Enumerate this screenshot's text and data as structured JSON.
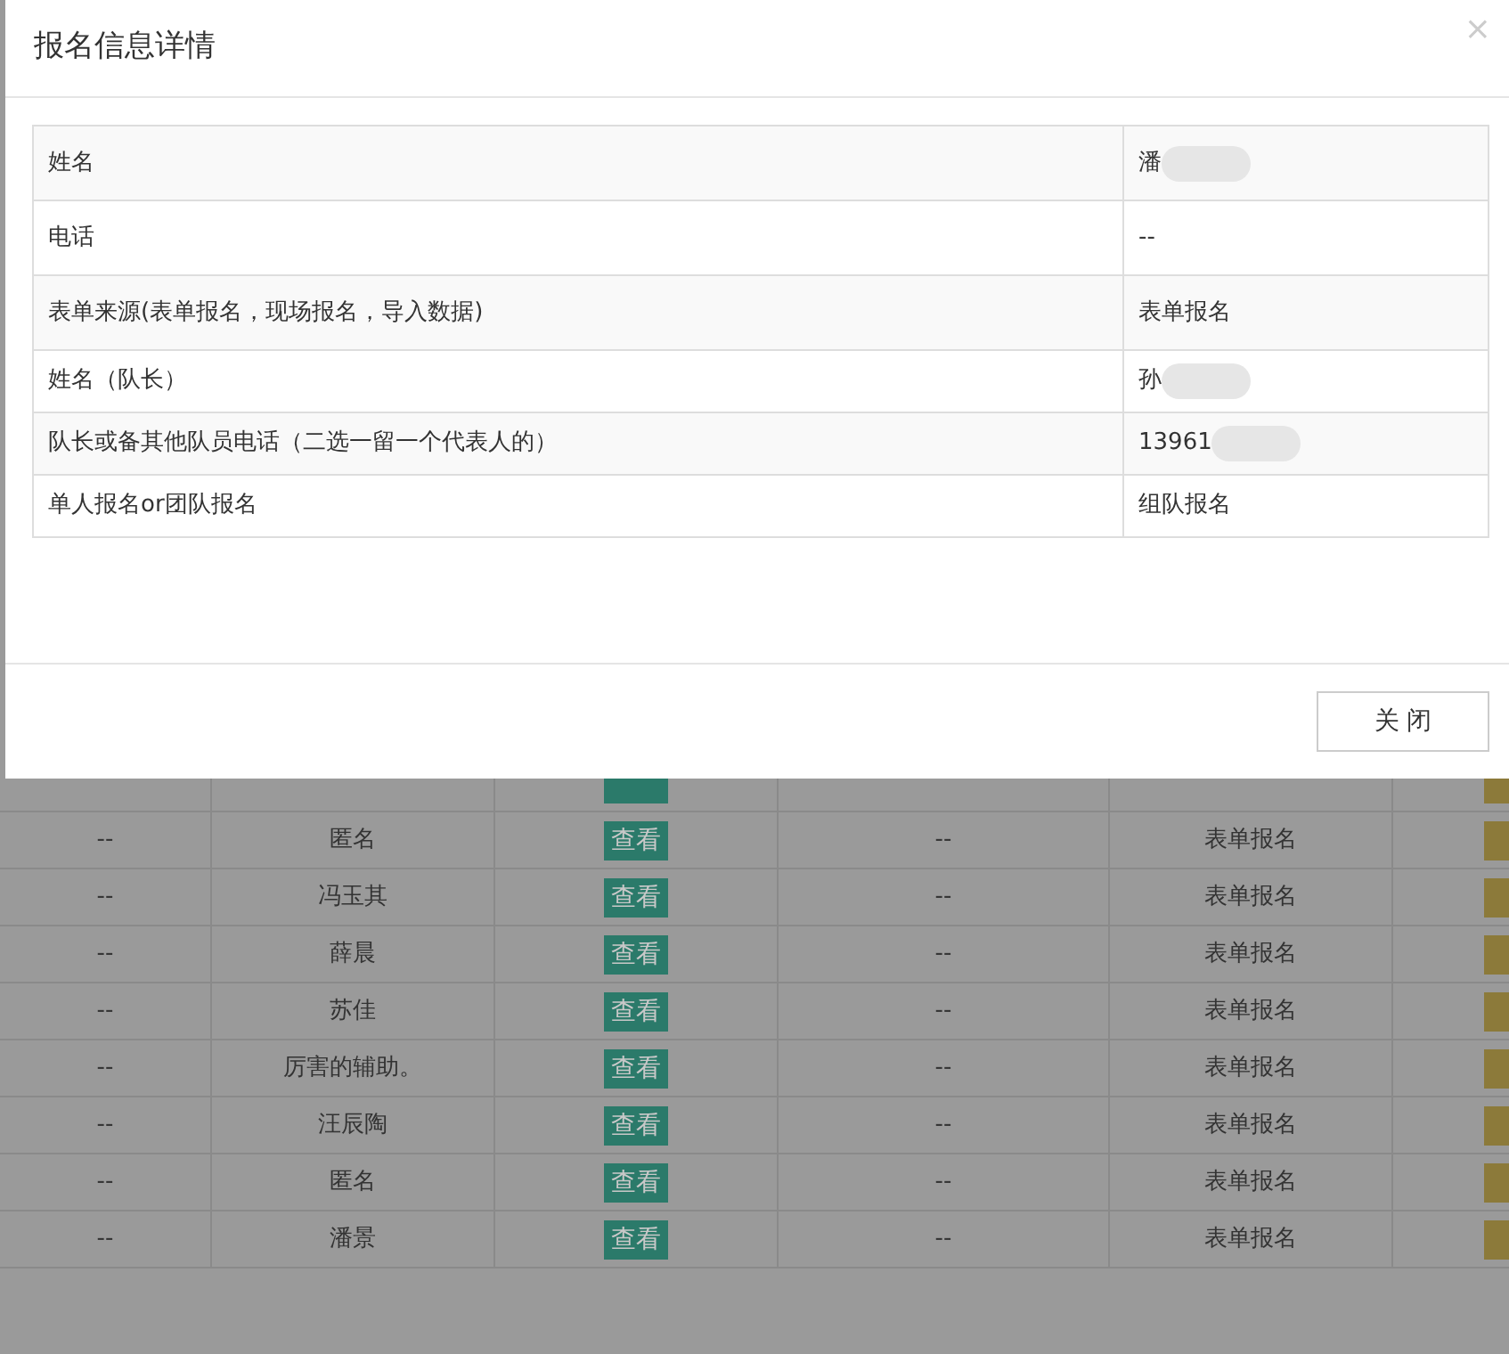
{
  "background_table": {
    "rows": [
      {
        "column_1": "--",
        "column_2": "匿名",
        "action": "查看",
        "column_4": "--",
        "column_5": "表单报名"
      },
      {
        "column_1": "--",
        "column_2": "冯玉其",
        "action": "查看",
        "column_4": "--",
        "column_5": "表单报名"
      },
      {
        "column_1": "--",
        "column_2": "薛晨",
        "action": "查看",
        "column_4": "--",
        "column_5": "表单报名"
      },
      {
        "column_1": "--",
        "column_2": "苏佳",
        "action": "查看",
        "column_4": "--",
        "column_5": "表单报名"
      },
      {
        "column_1": "--",
        "column_2": "厉害的辅助。",
        "action": "查看",
        "column_4": "--",
        "column_5": "表单报名"
      },
      {
        "column_1": "--",
        "column_2": "汪辰陶",
        "action": "查看",
        "column_4": "--",
        "column_5": "表单报名"
      },
      {
        "column_1": "--",
        "column_2": "匿名",
        "action": "查看",
        "column_4": "--",
        "column_5": "表单报名"
      },
      {
        "column_1": "--",
        "column_2": "潘景",
        "action": "查看",
        "column_4": "--",
        "column_5": "表单报名"
      }
    ]
  },
  "dialog": {
    "title": "报名信息详情",
    "close_icon": "×",
    "fields": [
      {
        "label": "姓名",
        "value": "潘",
        "redacted": true
      },
      {
        "label": "电话",
        "value": "--",
        "redacted": false
      },
      {
        "label": "表单来源(表单报名，现场报名，导入数据)",
        "value": "表单报名",
        "redacted": false
      },
      {
        "label": "姓名（队长）",
        "value": "孙",
        "redacted": true
      },
      {
        "label": "队长或备其他队员电话（二选一留一个代表人的）",
        "value": "13961",
        "redacted": true
      },
      {
        "label": "单人报名or团队报名",
        "value": "组队报名",
        "redacted": false
      }
    ],
    "buttons": [
      "关 闭"
    ]
  }
}
